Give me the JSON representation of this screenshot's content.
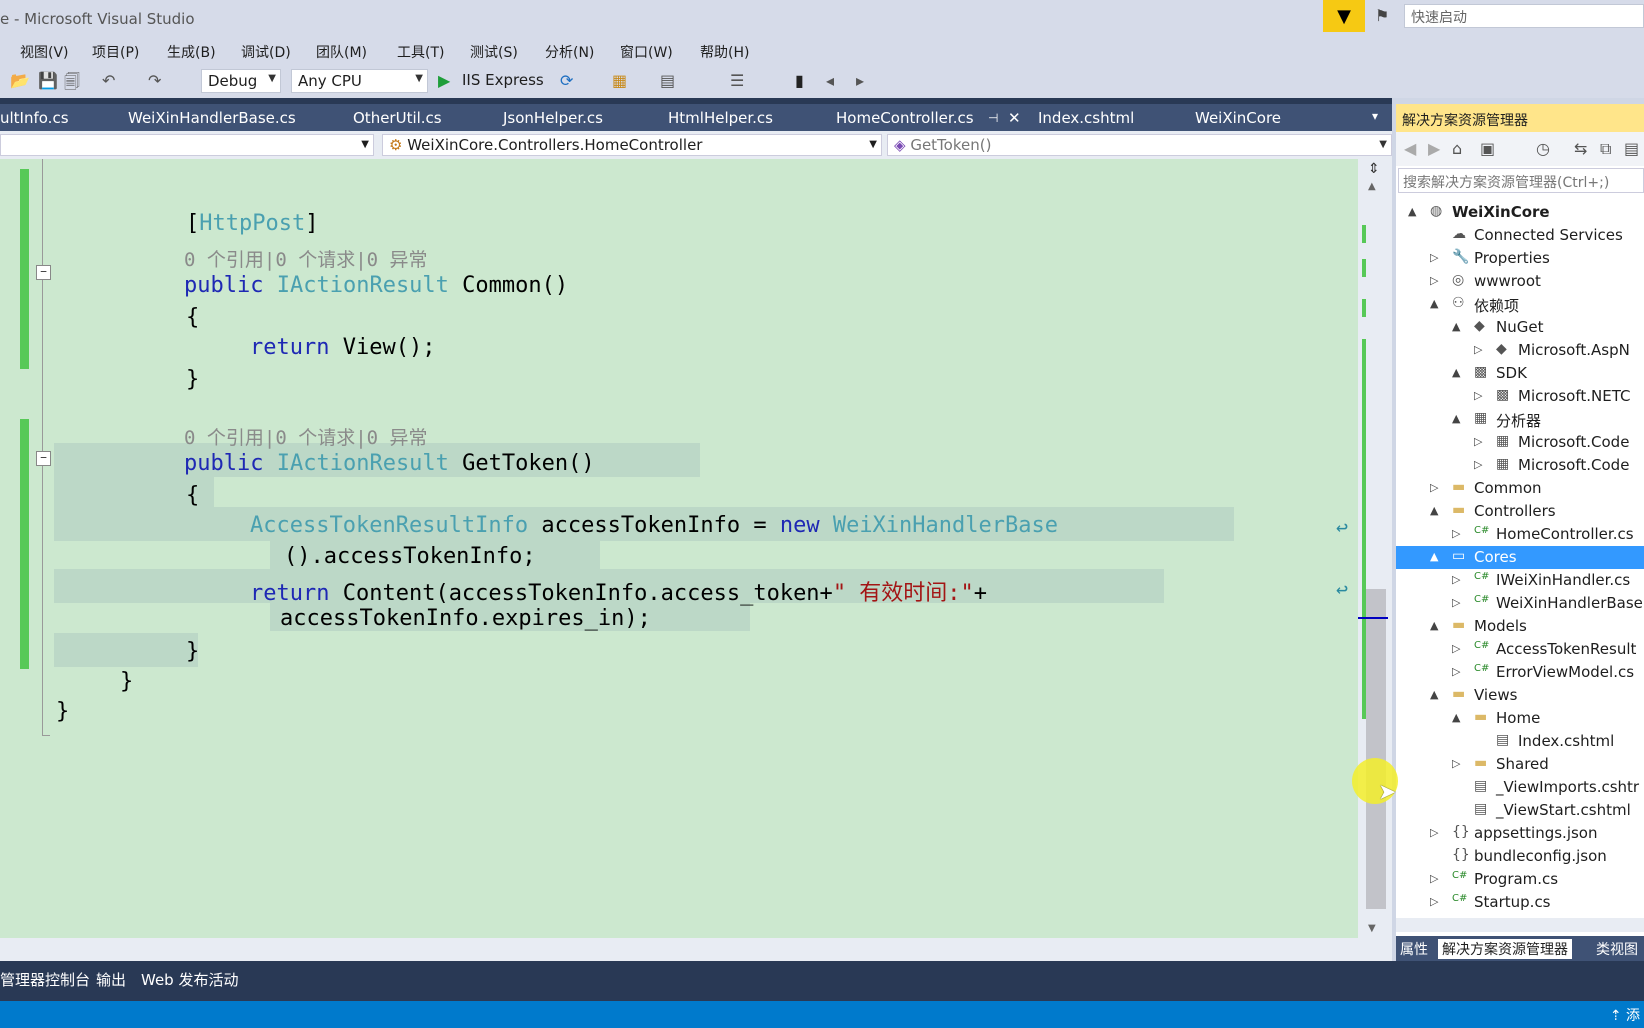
{
  "window": {
    "title": "e - Microsoft Visual Studio",
    "quick_launch_placeholder": "快速启动"
  },
  "menu": [
    "视图(V)",
    "项目(P)",
    "生成(B)",
    "调试(D)",
    "团队(M)",
    "工具(T)",
    "测试(S)",
    "分析(N)",
    "窗口(W)",
    "帮助(H)"
  ],
  "toolbar": {
    "config": "Debug",
    "platform": "Any CPU",
    "run": "IIS Express"
  },
  "tabs": [
    "ultInfo.cs",
    "WeiXinHandlerBase.cs",
    "OtherUtil.cs",
    "JsonHelper.cs",
    "HtmlHelper.cs",
    "HomeController.cs",
    "Index.cshtml",
    "WeiXinCore"
  ],
  "navbar": {
    "class": "WeiXinCore.Controllers.HomeController",
    "member": "GetToken()"
  },
  "code": {
    "attr_open": "[",
    "attr_name": "HttpPost",
    "attr_close": "]",
    "lens": "0 个引用|0 个请求|0 异常",
    "kw_public": "public",
    "type_result": "IActionResult",
    "method_common": " Common()",
    "brace_open": "{",
    "brace_close": "}",
    "kw_return": "return",
    "view_call": " View();",
    "method_gettoken": " GetToken()",
    "type_info": "AccessTokenResultInfo",
    "var_decl": " accessTokenInfo = ",
    "kw_new": "new",
    "type_handler": " WeiXinHandlerBase",
    "wrap1": "().accessTokenInfo;",
    "content_call": " Content(accessTokenInfo.access_token+",
    "str_valid": "\" 有效时间:\"",
    "plus": "+",
    "wrap2": "accessTokenInfo.expires_in);"
  },
  "solution_explorer": {
    "title": "解决方案资源管理器",
    "search_placeholder": "搜索解决方案资源管理器(Ctrl+;)",
    "items": [
      {
        "label": "WeiXinCore",
        "icon": "project-icon"
      },
      {
        "label": "Connected Services",
        "icon": "connected-services-icon"
      },
      {
        "label": "Properties",
        "icon": "wrench-icon"
      },
      {
        "label": "wwwroot",
        "icon": "globe-icon"
      },
      {
        "label": "依赖项",
        "icon": "dependencies-icon"
      },
      {
        "label": "NuGet",
        "icon": "nuget-icon"
      },
      {
        "label": "Microsoft.AspN",
        "icon": "package-icon"
      },
      {
        "label": "SDK",
        "icon": "sdk-icon"
      },
      {
        "label": "Microsoft.NETC",
        "icon": "sdk-icon"
      },
      {
        "label": "分析器",
        "icon": "analyzer-icon"
      },
      {
        "label": "Microsoft.Code",
        "icon": "analyzer-icon"
      },
      {
        "label": "Microsoft.Code",
        "icon": "analyzer-icon"
      },
      {
        "label": "Common",
        "icon": "folder-icon"
      },
      {
        "label": "Controllers",
        "icon": "folder-icon"
      },
      {
        "label": "HomeController.cs",
        "icon": "csharp-file-icon"
      },
      {
        "label": "Cores",
        "icon": "folder-open-icon"
      },
      {
        "label": "IWeiXinHandler.cs",
        "icon": "csharp-file-icon"
      },
      {
        "label": "WeiXinHandlerBase",
        "icon": "csharp-file-icon"
      },
      {
        "label": "Models",
        "icon": "folder-icon"
      },
      {
        "label": "AccessTokenResult",
        "icon": "csharp-file-icon"
      },
      {
        "label": "ErrorViewModel.cs",
        "icon": "csharp-file-icon"
      },
      {
        "label": "Views",
        "icon": "folder-icon"
      },
      {
        "label": "Home",
        "icon": "folder-icon"
      },
      {
        "label": "Index.cshtml",
        "icon": "razor-file-icon"
      },
      {
        "label": "Shared",
        "icon": "folder-icon"
      },
      {
        "label": "_ViewImports.cshtr",
        "icon": "razor-file-icon"
      },
      {
        "label": "_ViewStart.cshtml",
        "icon": "razor-file-icon"
      },
      {
        "label": "appsettings.json",
        "icon": "json-file-icon"
      },
      {
        "label": "bundleconfig.json",
        "icon": "json-file-icon"
      },
      {
        "label": "Program.cs",
        "icon": "csharp-file-icon"
      },
      {
        "label": "Startup.cs",
        "icon": "csharp-file-icon"
      }
    ],
    "tabs": [
      "属性",
      "解决方案资源管理器",
      "类视图"
    ]
  },
  "tool_tabs": [
    "管理器控制台",
    "输出",
    "Web 发布活动"
  ],
  "status": {
    "right": "添"
  },
  "colors": {
    "accent": "#007acc",
    "selection": "#3399ff",
    "editor_bg": "#cce8cf",
    "keyword": "#1e28b4",
    "type": "#4aa0b0",
    "string": "#a31515"
  }
}
